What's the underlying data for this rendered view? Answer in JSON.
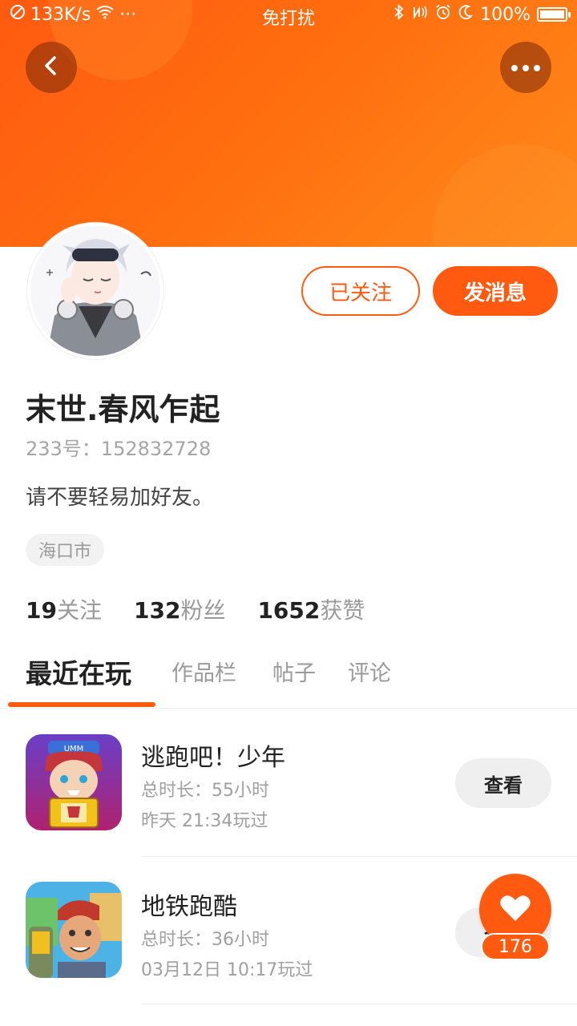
{
  "status_bar": {
    "speed": "133K/s",
    "dots": "···",
    "mode": "免打扰",
    "battery": "100%"
  },
  "header": {
    "back_icon": "chevron-left-icon",
    "more_icon": "more-dots-icon"
  },
  "profile": {
    "follow_label": "已关注",
    "message_label": "发消息",
    "username": "末世.春风乍起",
    "id_label": "233号：152832728",
    "bio": "请不要轻易加好友。",
    "location": "海口市",
    "stats": {
      "following_count": "19",
      "following_label": "关注",
      "fans_count": "132",
      "fans_label": "粉丝",
      "likes_count": "1652",
      "likes_label": "获赞"
    }
  },
  "tabs": [
    {
      "label": "最近在玩",
      "active": true
    },
    {
      "label": "作品栏",
      "active": false
    },
    {
      "label": "帖子",
      "active": false
    },
    {
      "label": "评论",
      "active": false
    }
  ],
  "games": [
    {
      "name": "逃跑吧！少年",
      "duration": "总时长：55小时",
      "last_played": "昨天 21:34玩过",
      "action": "查看"
    },
    {
      "name": "地铁跑酷",
      "duration": "总时长：36小时",
      "last_played": "03月12日 10:17玩过",
      "action": "查看"
    }
  ],
  "like_fab": {
    "count": "176",
    "icon": "heart-icon"
  },
  "colors": {
    "accent": "#ff5a10"
  }
}
